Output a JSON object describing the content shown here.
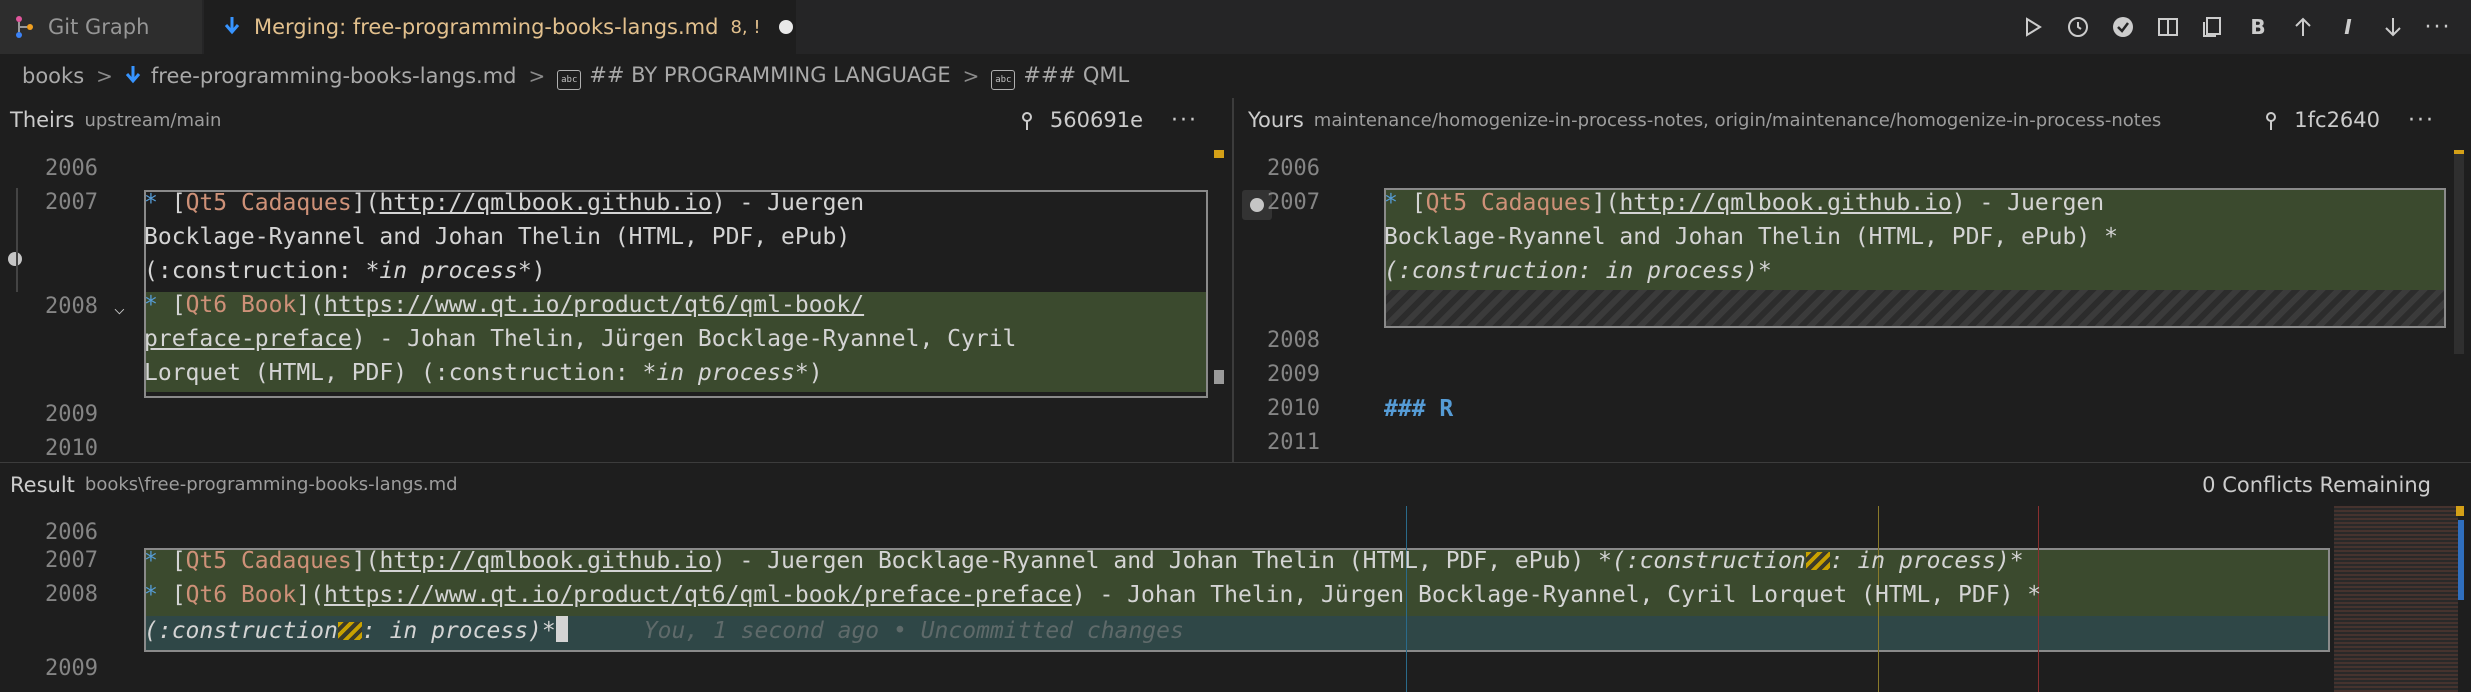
{
  "tabs": [
    {
      "label": "Git Graph"
    },
    {
      "label": "Merging: free-programming-books-langs.md",
      "badge": "8, !"
    }
  ],
  "toolbar": {
    "bold": "B",
    "italic": "I",
    "more": "···"
  },
  "breadcrumb": {
    "folder": "books",
    "file": "free-programming-books-langs.md",
    "section": "## BY PROGRAMMING LANGUAGE",
    "subsection": "### QML"
  },
  "theirs": {
    "title": "Theirs",
    "branch": "upstream/main",
    "commit": "560691e",
    "more": "···",
    "lines": [
      "2006",
      "2007",
      "2008",
      "2009",
      "2010"
    ]
  },
  "yours": {
    "title": "Yours",
    "branch": "maintenance/homogenize-in-process-notes, origin/maintenance/homogenize-in-process-notes",
    "commit": "1fc2640",
    "more": "···",
    "lines": [
      "2006",
      "2007",
      "2008",
      "2009",
      "2010",
      "2011"
    ],
    "heading": "### R"
  },
  "result": {
    "title": "Result",
    "path": "books\\free-programming-books-langs.md",
    "conflicts": "0 Conflicts Remaining",
    "lines": [
      "2006",
      "2007",
      "2008",
      "2009"
    ],
    "blame": "You, 1 second ago • Uncommitted changes"
  },
  "text": {
    "qt5_name": "Qt5 Cadaques",
    "qt5_url": "http://qmlbook.github.io",
    "qt5_authors_a": " - Juergen",
    "qt5_authors_b": "Bocklage-Ryannel and Johan Thelin (HTML, PDF, ePub)",
    "qt5_authors_full": " - Juergen Bocklage-Ryannel and Johan Thelin (HTML, PDF, ePub) ",
    "qt6_name": "Qt6 Book",
    "qt6_url_a": "https://www.qt.io/product/qt6/qml-book/",
    "qt6_url_b": "preface-preface",
    "qt6_url_full": "https://www.qt.io/product/qt6/qml-book/preface-preface",
    "qt6_authors_a": " - Johan Thelin, Jürgen Bocklage-Ryannel, Cyril",
    "qt6_authors_b": "Lorquet (HTML, PDF) ",
    "qt6_authors_full": " - Johan Thelin, Jürgen Bocklage-Ryannel, Cyril Lorquet (HTML, PDF) ",
    "construction": "(:construction: ",
    "in_process": "in process",
    "construction_open": "(:construction",
    "in_process_tail": ": in process)",
    "in_process_star": "*in process*",
    "star": "*",
    "close_paren": ")"
  },
  "colors": {
    "accent": "#e2c08d",
    "link": "#ce9178",
    "bullet": "#569cd6"
  }
}
